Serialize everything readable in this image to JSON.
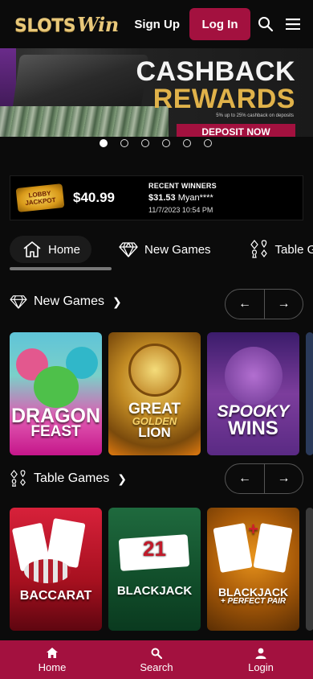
{
  "header": {
    "logo_part1": "SLOTS",
    "logo_part2": "Win",
    "signup_label": "Sign Up",
    "login_label": "Log In"
  },
  "banner": {
    "line1": "CASHBACK",
    "line2": "REWARDS",
    "fine_print": "5% up to 25% cashback on deposits",
    "cta": "DEPOSIT NOW"
  },
  "carousel": {
    "dot_count": 6,
    "active_index": 0
  },
  "jackpot": {
    "logo_text": "LOBBY JACKPOT",
    "amount": "$40.99",
    "title": "RECENT WINNERS",
    "win_amount": "$31.53",
    "win_user": "Myan****",
    "win_date": "11/7/2023 10:54 PM"
  },
  "tabs": [
    {
      "label": "Home",
      "icon": "home-icon",
      "active": true
    },
    {
      "label": "New Games",
      "icon": "diamond-icon",
      "active": false
    },
    {
      "label": "Table Games",
      "icon": "card-suits-icon",
      "active": false
    }
  ],
  "sections": {
    "new_games": {
      "title": "New Games",
      "games": [
        {
          "line1": "DRAGON",
          "line2": "FEAST"
        },
        {
          "line1": "GREAT",
          "line2": "GOLDEN",
          "line3": "LION"
        },
        {
          "line1": "SPOOKY",
          "line2": "WINS"
        }
      ]
    },
    "table_games": {
      "title": "Table Games",
      "games": [
        {
          "line1": "BACCARAT"
        },
        {
          "line1": "BLACKJACK",
          "badge": "21"
        },
        {
          "line1": "BLACKJACK",
          "line2": "+ PERFECT PAIR"
        }
      ]
    }
  },
  "bottom_nav": {
    "home": "Home",
    "search": "Search",
    "login": "Login"
  },
  "colors": {
    "accent": "#a3113f",
    "gold": "#e0b24a",
    "background": "#0b0b0b"
  }
}
